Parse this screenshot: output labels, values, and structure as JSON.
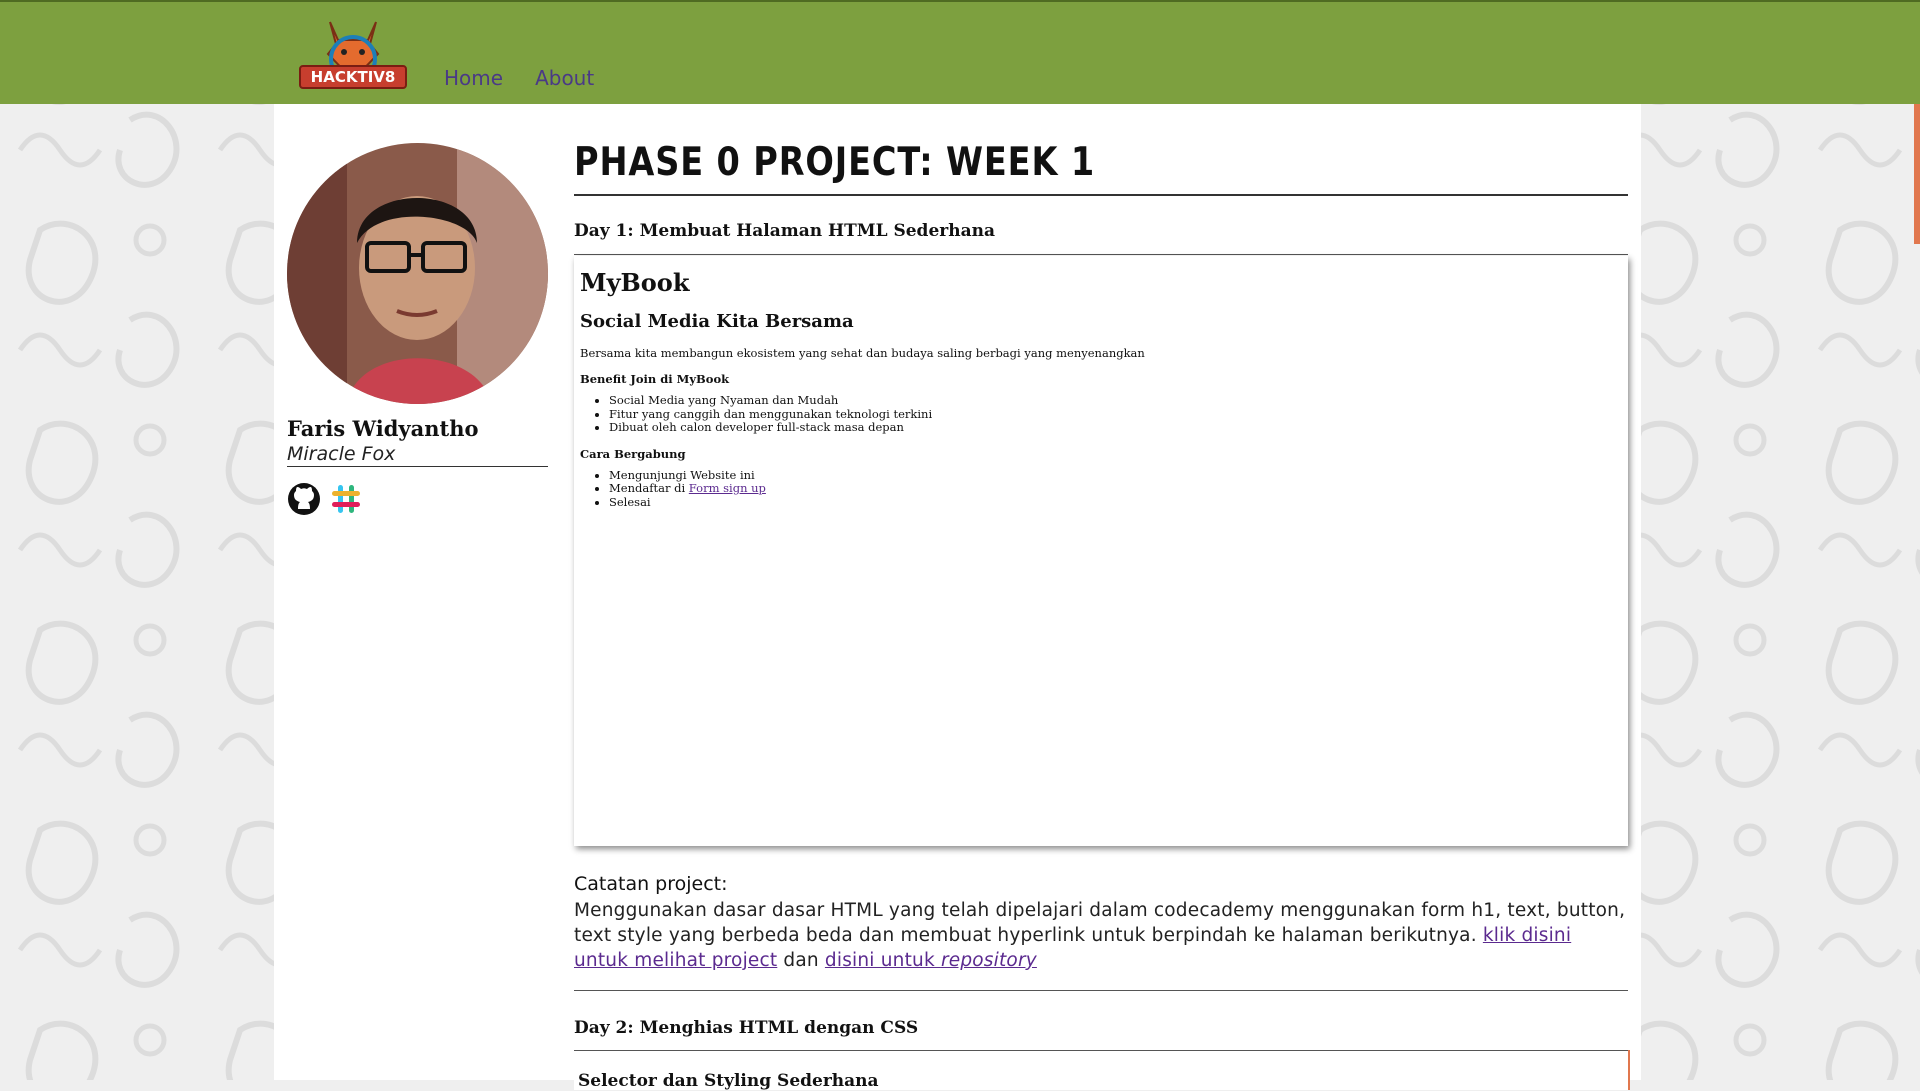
{
  "nav": {
    "brand": "HACKTIV8",
    "items": [
      "Home",
      "About"
    ]
  },
  "profile": {
    "name": "Faris Widyantho",
    "nickname": "Miracle Fox",
    "social_icons": [
      "github-icon",
      "slack-icon"
    ]
  },
  "main": {
    "title": "PHASE 0 PROJECT: WEEK 1",
    "day1": {
      "title": "Day 1: Membuat Halaman HTML Sederhana",
      "preview": {
        "h1": "MyBook",
        "h2": "Social Media Kita Bersama",
        "intro": "Bersama kita membangun ekosistem yang sehat dan budaya saling berbagi yang menyenangkan",
        "benefit_title": "Benefit Join di MyBook",
        "benefits": [
          "Social Media yang Nyaman dan Mudah",
          "Fitur yang canggih dan menggunakan teknologi terkini",
          "Dibuat oleh calon developer full-stack masa depan"
        ],
        "join_title": "Cara Bergabung",
        "join_1": "Mengunjungi Website ini",
        "join_2_prefix": "Mendaftar di ",
        "join_2_link": "Form sign up",
        "join_3": "Selesai"
      },
      "notes_title": "Catatan project:",
      "notes_text": "Menggunakan dasar dasar HTML yang telah dipelajari dalam codecademy menggunakan form h1, text, button, text style yang berbeda beda dan membuat hyperlink untuk berpindah ke halaman berikutnya.",
      "notes_link1": "klik disini untuk melihat project",
      "notes_and": "dan",
      "notes_link2_prefix": "disini untuk ",
      "notes_link2_em": "repository"
    },
    "day2": {
      "title": "Day 2: Menghias HTML dengan CSS",
      "preview_heading": "Selector dan Styling Sederhana"
    }
  },
  "colors": {
    "header": "#7da03f",
    "link": "#5b2a8f",
    "accent": "#e1774e"
  }
}
